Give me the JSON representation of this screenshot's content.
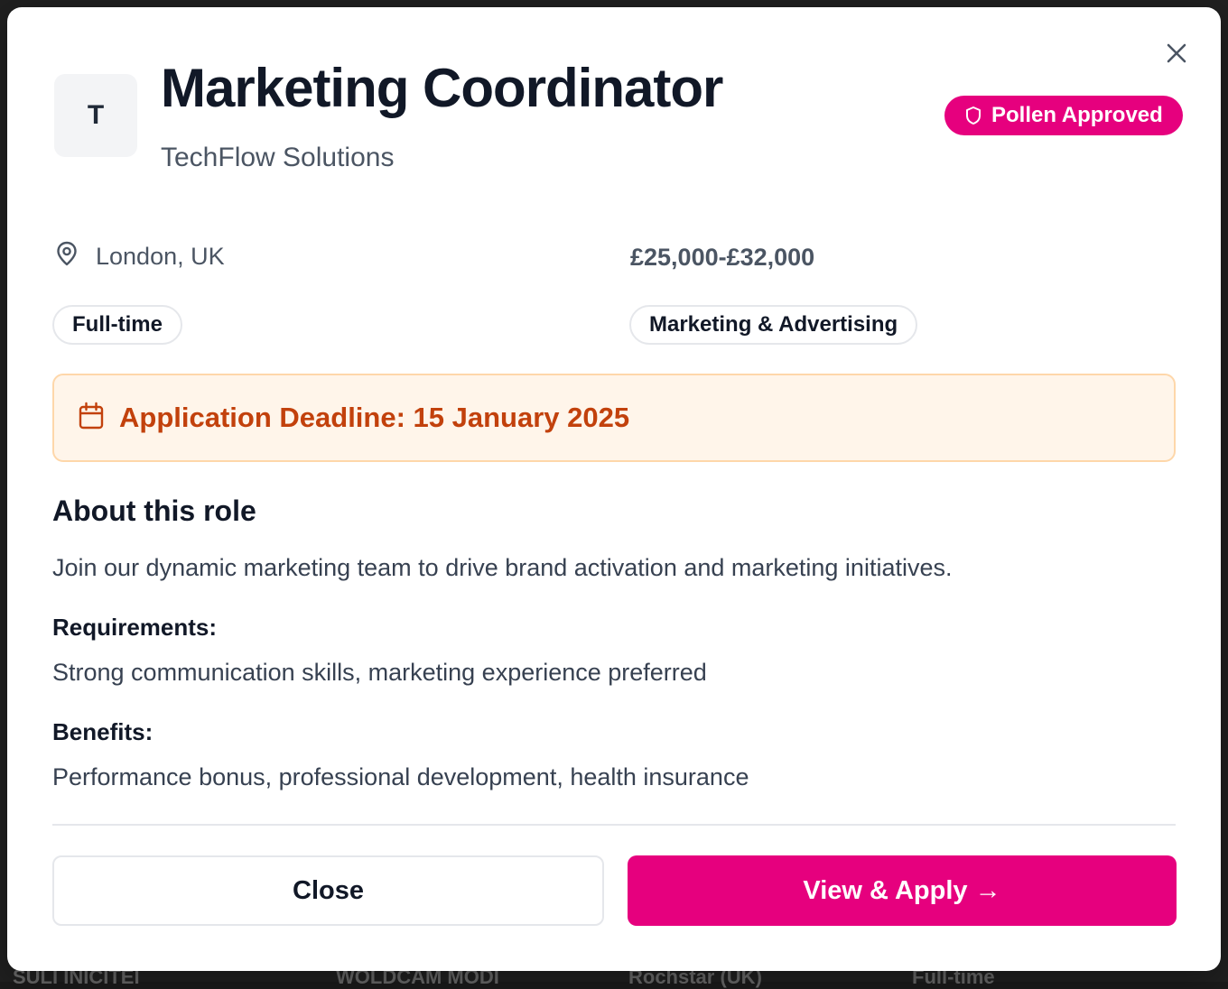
{
  "backdrop": {
    "fragments": [
      "SULI INICITEI",
      "WOLDCAM MODI",
      "Rochstar (UK)",
      "Full-time"
    ]
  },
  "modal": {
    "close_icon": "close-icon",
    "logo_letter": "T",
    "title": "Marketing Coordinator",
    "company": "TechFlow Solutions",
    "badge": {
      "icon": "shield-icon",
      "label": "Pollen Approved",
      "color": "#e6007e"
    },
    "location": {
      "icon": "map-pin-icon",
      "text": "London, UK"
    },
    "salary": "£25,000-£32,000",
    "tags": {
      "type": "Full-time",
      "category": "Marketing & Advertising"
    },
    "deadline": {
      "icon": "calendar-icon",
      "text": "Application Deadline: 15 January 2025",
      "color": "#c2410c"
    },
    "about": {
      "heading": "About this role",
      "description": "Join our dynamic marketing team to drive brand activation and marketing initiatives.",
      "requirements_label": "Requirements:",
      "requirements": "Strong communication skills, marketing experience preferred",
      "benefits_label": "Benefits:",
      "benefits": "Performance bonus, professional development, health insurance"
    },
    "actions": {
      "close_label": "Close",
      "apply_label": "View & Apply →",
      "accent": "#e6007e"
    }
  }
}
